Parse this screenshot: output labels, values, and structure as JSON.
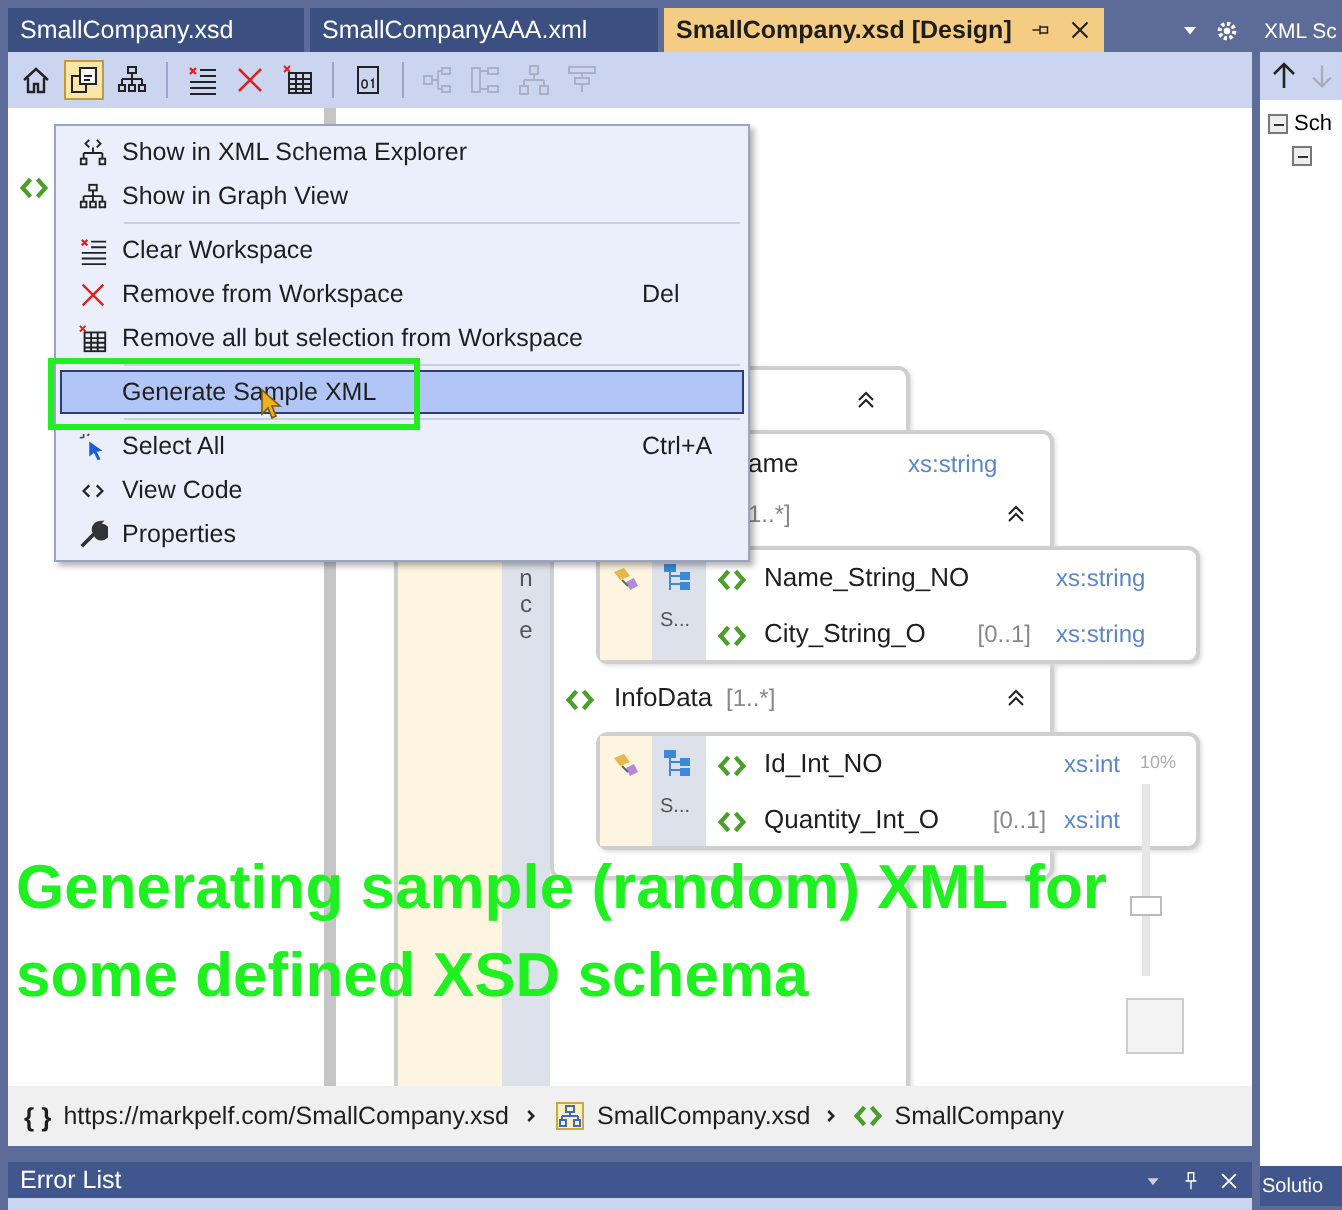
{
  "document_tabs": [
    {
      "label": "SmallCompany.xsd",
      "selected": false
    },
    {
      "label": "SmallCompanyAAA.xml",
      "selected": false
    },
    {
      "label": "SmallCompany.xsd [Design]",
      "selected": true
    }
  ],
  "toolbar": [
    {
      "kind": "home",
      "selected": false,
      "disabled": false
    },
    {
      "kind": "workspace",
      "selected": true,
      "disabled": false
    },
    {
      "kind": "graph",
      "selected": false,
      "disabled": false
    },
    {
      "kind": "separator"
    },
    {
      "kind": "clear",
      "selected": false,
      "disabled": false
    },
    {
      "kind": "remove",
      "selected": false,
      "disabled": false
    },
    {
      "kind": "table",
      "selected": false,
      "disabled": false
    },
    {
      "kind": "separator"
    },
    {
      "kind": "sample",
      "selected": false,
      "disabled": false
    },
    {
      "kind": "separator"
    },
    {
      "kind": "layout-left",
      "selected": false,
      "disabled": true
    },
    {
      "kind": "layout-right",
      "selected": false,
      "disabled": true
    },
    {
      "kind": "layout-top",
      "selected": false,
      "disabled": true
    },
    {
      "kind": "layout-bottom",
      "selected": false,
      "disabled": true
    }
  ],
  "canvas": {
    "sequence_label": "nce",
    "top_element": {
      "name": "ame",
      "type": "xs:string"
    },
    "groups": [
      {
        "occurs": "1..*]",
        "compositor": "S...",
        "elements": [
          {
            "name": "Name_String_NO",
            "type": "xs:string"
          },
          {
            "name": "City_String_O",
            "occurs": "[0..1]",
            "type": "xs:string"
          }
        ]
      },
      {
        "name": "InfoData",
        "occurs": "[1..*]",
        "compositor": "S...",
        "elements": [
          {
            "name": "Id_Int_NO",
            "type": "xs:int"
          },
          {
            "name": "Quantity_Int_O",
            "occurs": "[0..1]",
            "type": "xs:int"
          }
        ]
      }
    ],
    "zoom": {
      "label": "10%",
      "level": 0.35
    }
  },
  "context_menu": [
    {
      "kind": "item",
      "label": "Show in XML Schema Explorer",
      "selected": false
    },
    {
      "kind": "item",
      "label": "Show in Graph View",
      "selected": false
    },
    {
      "kind": "separator"
    },
    {
      "kind": "item",
      "label": "Clear Workspace",
      "selected": false
    },
    {
      "kind": "item",
      "label": "Remove from Workspace",
      "shortcut": "Del",
      "selected": false
    },
    {
      "kind": "item",
      "label": "Remove all but selection from Workspace",
      "selected": false
    },
    {
      "kind": "separator"
    },
    {
      "kind": "item",
      "label": "Generate Sample XML",
      "selected": true
    },
    {
      "kind": "separator"
    },
    {
      "kind": "item",
      "label": "Select All",
      "shortcut": "Ctrl+A",
      "selected": false
    },
    {
      "kind": "item",
      "label": "View Code",
      "selected": false
    },
    {
      "kind": "item",
      "label": "Properties",
      "selected": false
    }
  ],
  "breadcrumb": {
    "namespace": "{ }",
    "url": "https://markpelf.com/SmallCompany.xsd",
    "file": "SmallCompany.xsd",
    "element": "SmallCompany"
  },
  "error_list": {
    "title": "Error List"
  },
  "side_panel": {
    "title": "XML Sc",
    "tree": [
      {
        "label": "Sch",
        "expanded": true,
        "children": [
          {
            "expanded": true
          }
        ]
      }
    ],
    "bottom_tab": "Solutio"
  },
  "caption": [
    "Generating sample (random) XML for",
    "some defined XSD schema"
  ]
}
